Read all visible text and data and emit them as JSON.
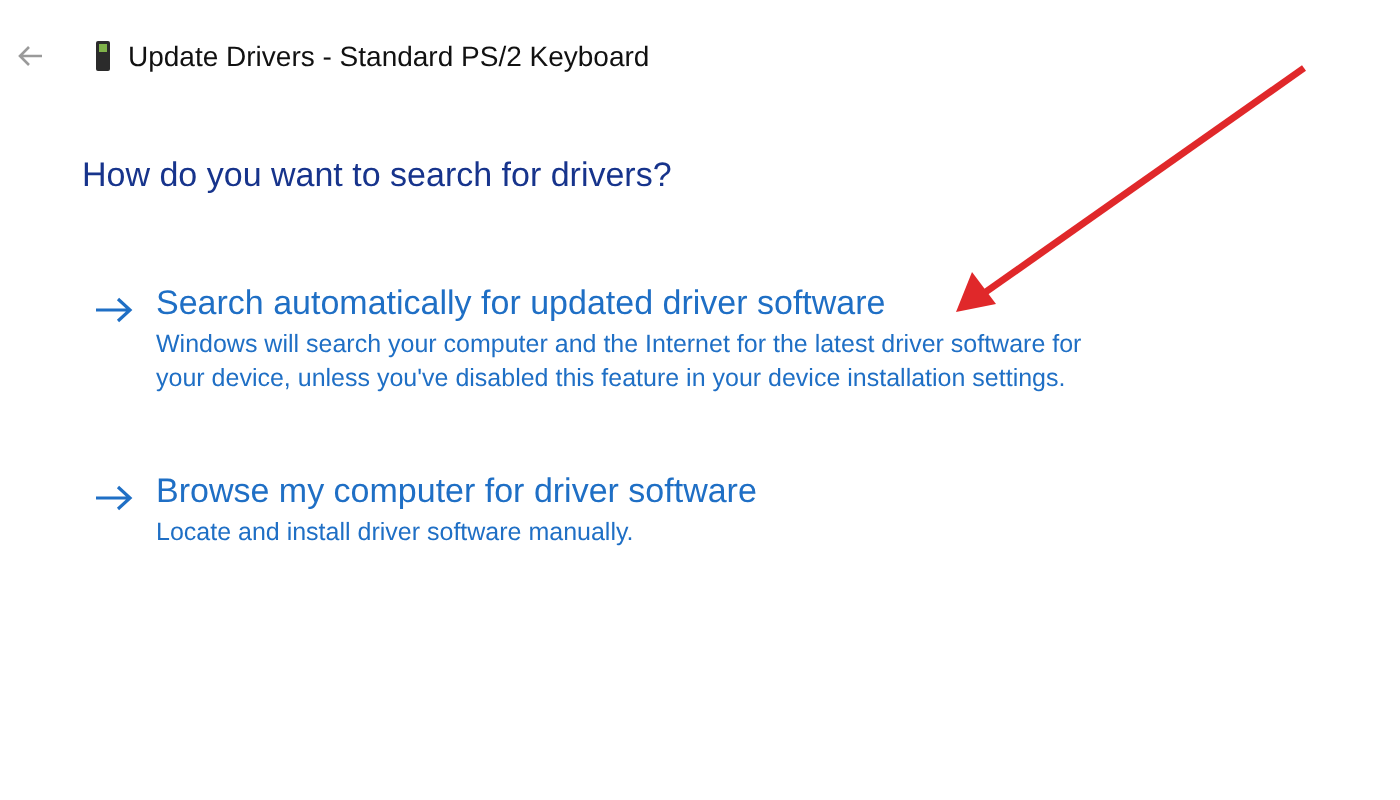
{
  "window": {
    "title": "Update Drivers - Standard PS/2 Keyboard"
  },
  "heading": "How do you want to search for drivers?",
  "options": [
    {
      "title": "Search automatically for updated driver software",
      "description": "Windows will search your computer and the Internet for the latest driver software for your device, unless you've disabled this feature in your device installation settings."
    },
    {
      "title": "Browse my computer for driver software",
      "description": "Locate and install driver software manually."
    }
  ]
}
